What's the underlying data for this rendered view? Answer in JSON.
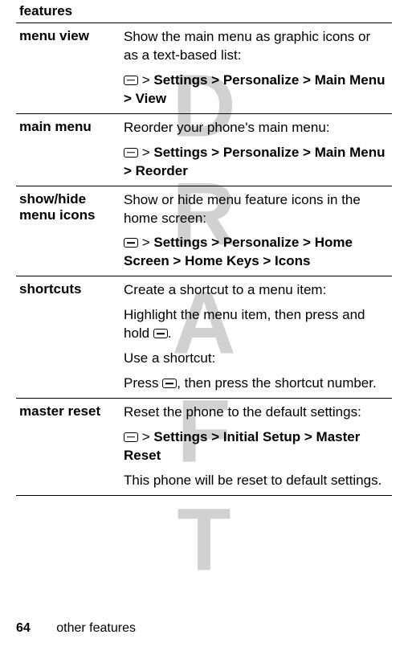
{
  "watermark": "DRAFT",
  "table": {
    "header": "features",
    "rows": [
      {
        "feature": "menu view",
        "desc": "Show the main menu as graphic icons or as a text-based list:",
        "path_suffix": "Settings > Personalize > Main Menu > View"
      },
      {
        "feature": "main menu",
        "desc": "Reorder your phone's main menu:",
        "path_suffix": "Settings > Personalize > Main Menu > Reorder"
      },
      {
        "feature": "show/hide menu icons",
        "desc": "Show or hide menu feature icons in the home screen:",
        "path_suffix": "Settings > Personalize > Home Screen > Home Keys > Icons"
      },
      {
        "feature": "shortcuts",
        "desc1": "Create a shortcut to a menu item:",
        "desc2_pre": "Highlight the menu item, then press and hold ",
        "desc2_post": ".",
        "desc3": "Use a shortcut:",
        "desc4_pre": "Press ",
        "desc4_post": ", then press the shortcut number."
      },
      {
        "feature": "master reset",
        "desc": "Reset the phone to the default settings:",
        "path_suffix": "Settings > Initial Setup > Master Reset",
        "desc_after": "This phone will be reset to default settings."
      }
    ]
  },
  "footer": {
    "page": "64",
    "section": "other features"
  }
}
